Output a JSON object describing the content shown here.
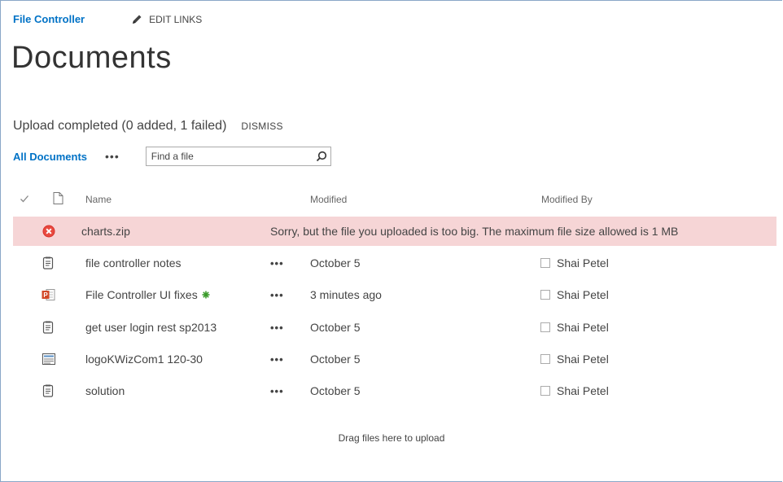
{
  "nav": {
    "site_title": "File Controller",
    "edit_links_label": "EDIT LINKS"
  },
  "page": {
    "title": "Documents"
  },
  "upload": {
    "status": "Upload completed (0 added, 1 failed)",
    "dismiss_label": "DISMISS"
  },
  "toolbar": {
    "view_label": "All Documents",
    "more_label": "•••",
    "search_placeholder": "Find a file"
  },
  "columns": {
    "name": "Name",
    "modified": "Modified",
    "modified_by": "Modified By"
  },
  "error_row": {
    "name": "charts.zip",
    "message": "Sorry, but the file you uploaded is too big. The maximum file size allowed is 1 MB",
    "icon": "error-icon"
  },
  "files": [
    {
      "name": "file controller notes",
      "modified": "October 5",
      "modified_by": "Shai Petel",
      "icon": "text-document-icon",
      "is_new": false
    },
    {
      "name": "File Controller UI fixes",
      "modified": "3 minutes ago",
      "modified_by": "Shai Petel",
      "icon": "powerpoint-icon",
      "is_new": true
    },
    {
      "name": "get user login rest sp2013",
      "modified": "October 5",
      "modified_by": "Shai Petel",
      "icon": "text-document-icon",
      "is_new": false
    },
    {
      "name": "logoKWizCom1 120-30",
      "modified": "October 5",
      "modified_by": "Shai Petel",
      "icon": "image-icon",
      "is_new": false
    },
    {
      "name": "solution",
      "modified": "October 5",
      "modified_by": "Shai Petel",
      "icon": "text-document-icon",
      "is_new": false
    }
  ],
  "row_ellipsis": "•••",
  "footer": {
    "drag_hint": "Drag files here to upload"
  },
  "colors": {
    "link_blue": "#0072c6",
    "error_row_bg": "#f6d5d6",
    "new_marker_green": "#3a9a2a"
  }
}
